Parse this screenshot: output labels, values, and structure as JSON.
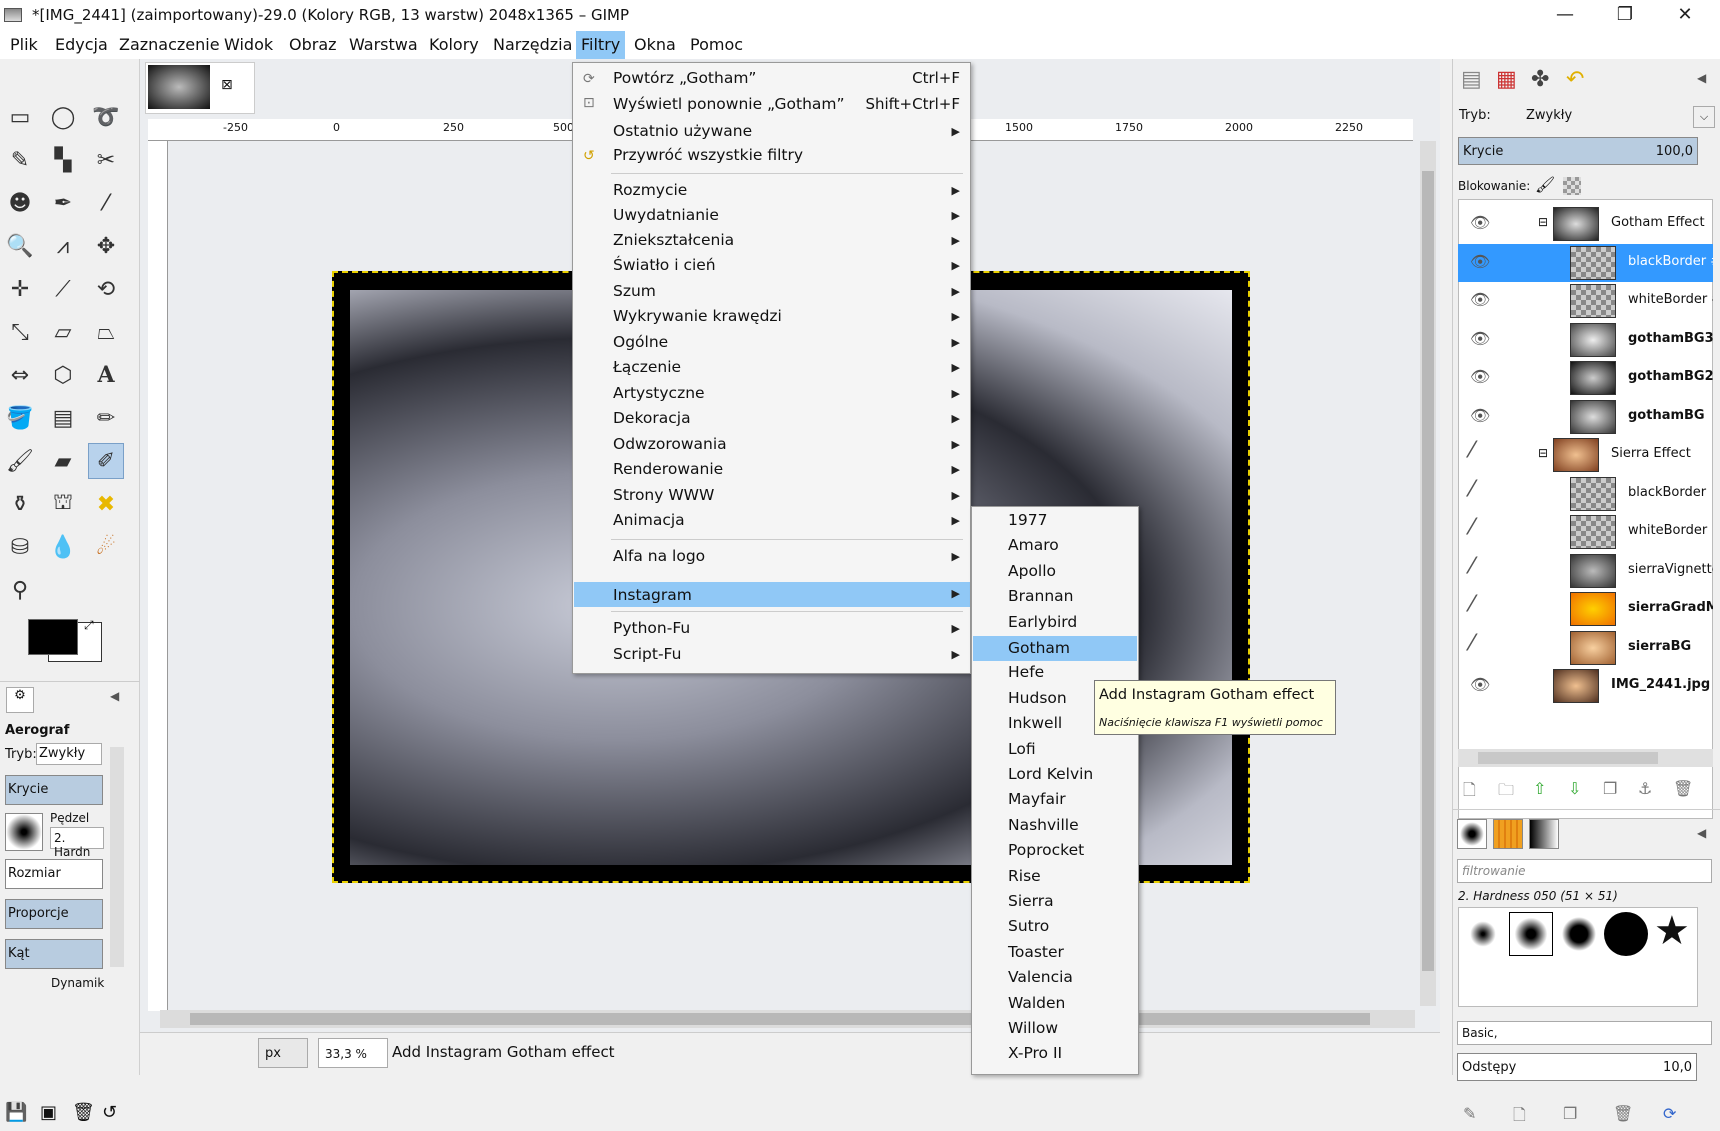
{
  "window": {
    "title": "*[IMG_2441] (zaimportowany)-29.0 (Kolory RGB, 13 warstw) 2048x1365 – GIMP",
    "minimize": "—",
    "maximize": "❐",
    "close": "✕"
  },
  "menubar": [
    "Plik",
    "Edycja",
    "Zaznaczenie",
    "Widok",
    "Obraz",
    "Warstwa",
    "Kolory",
    "Narzędzia",
    "Filtry",
    "Okna",
    "Pomoc"
  ],
  "ruler_labels": [
    "-250",
    "0",
    "250",
    "500",
    "1500",
    "1750",
    "2000",
    "2250"
  ],
  "filters_menu": {
    "top": [
      {
        "label": "Powtórz „Gotham”",
        "shortcut": "Ctrl+F"
      },
      {
        "label": "Wyświetl ponownie „Gotham”",
        "shortcut": "Shift+Ctrl+F"
      },
      {
        "label": "Ostatnio używane"
      },
      {
        "label": "Przywróć wszystkie filtry"
      }
    ],
    "groups": [
      "Rozmycie",
      "Uwydatnianie",
      "Zniekształcenia",
      "Światło i cień",
      "Szum",
      "Wykrywanie krawędzi",
      "Ogólne",
      "Łączenie",
      "Artystyczne",
      "Dekoracja",
      "Odwzorowania",
      "Renderowanie",
      "Strony WWW",
      "Animacja"
    ],
    "extra": [
      "Alfa na logo",
      "Instagram"
    ],
    "scripts": [
      "Python-Fu",
      "Script-Fu"
    ]
  },
  "instagram_submenu": [
    "1977",
    "Amaro",
    "Apollo",
    "Brannan",
    "Earlybird",
    "Gotham",
    "Hefe",
    "Hudson",
    "Inkwell",
    "Lofi",
    "Lord Kelvin",
    "Mayfair",
    "Nashville",
    "Poprocket",
    "Rise",
    "Sierra",
    "Sutro",
    "Toaster",
    "Valencia",
    "Walden",
    "Willow",
    "X-Pro II"
  ],
  "tooltip": {
    "title": "Add Instagram Gotham effect",
    "hint": "Naciśnięcie klawisza F1 wyświetli pomoc"
  },
  "status": {
    "unit": "px",
    "zoom": "33,3 %",
    "message": "Add Instagram Gotham effect"
  },
  "tool_options": {
    "title": "Aerograf",
    "mode_label": "Tryb:",
    "mode_value": "Zwykły",
    "opacity_label": "Krycie",
    "brush_label": "Pędzel",
    "brush_value": "2. Hardn",
    "size_label": "Rozmiar",
    "aspect_label": "Proporcje",
    "angle_label": "Kąt",
    "dynamics_label": "Dynamik"
  },
  "layers_panel": {
    "mode_label": "Tryb:",
    "mode_value": "Zwykły",
    "opacity_label": "Krycie",
    "opacity_value": "100,0",
    "lock_label": "Blokowanie:",
    "layers": [
      {
        "name": "Gotham Effect",
        "visible": true,
        "group": true,
        "indent": 0,
        "bold": false
      },
      {
        "name": "blackBorder #",
        "visible": true,
        "indent": 1,
        "selected": true,
        "bold": false
      },
      {
        "name": "whiteBorder #",
        "visible": true,
        "indent": 1,
        "bold": false
      },
      {
        "name": "gothamBG3",
        "visible": true,
        "indent": 1,
        "bold": true
      },
      {
        "name": "gothamBG2",
        "visible": true,
        "indent": 1,
        "bold": true
      },
      {
        "name": "gothamBG",
        "visible": true,
        "indent": 1,
        "bold": true
      },
      {
        "name": "Sierra Effect",
        "visible": false,
        "group": true,
        "indent": 0,
        "bold": false
      },
      {
        "name": "blackBorder",
        "visible": false,
        "indent": 1,
        "bold": false
      },
      {
        "name": "whiteBorder",
        "visible": false,
        "indent": 1,
        "bold": false
      },
      {
        "name": "sierraVignette",
        "visible": false,
        "indent": 1,
        "bold": false
      },
      {
        "name": "sierraGradM…",
        "visible": false,
        "indent": 1,
        "bold": true
      },
      {
        "name": "sierraBG",
        "visible": false,
        "indent": 1,
        "bold": true
      },
      {
        "name": "IMG_2441.jpg",
        "visible": true,
        "indent": 0,
        "bold": true
      }
    ]
  },
  "brushes_panel": {
    "filter_placeholder": "filtrowanie",
    "brush_name": "2. Hardness 050 (51 × 51)",
    "preset": "Basic,",
    "spacing_label": "Odstępy",
    "spacing_value": "10,0"
  }
}
